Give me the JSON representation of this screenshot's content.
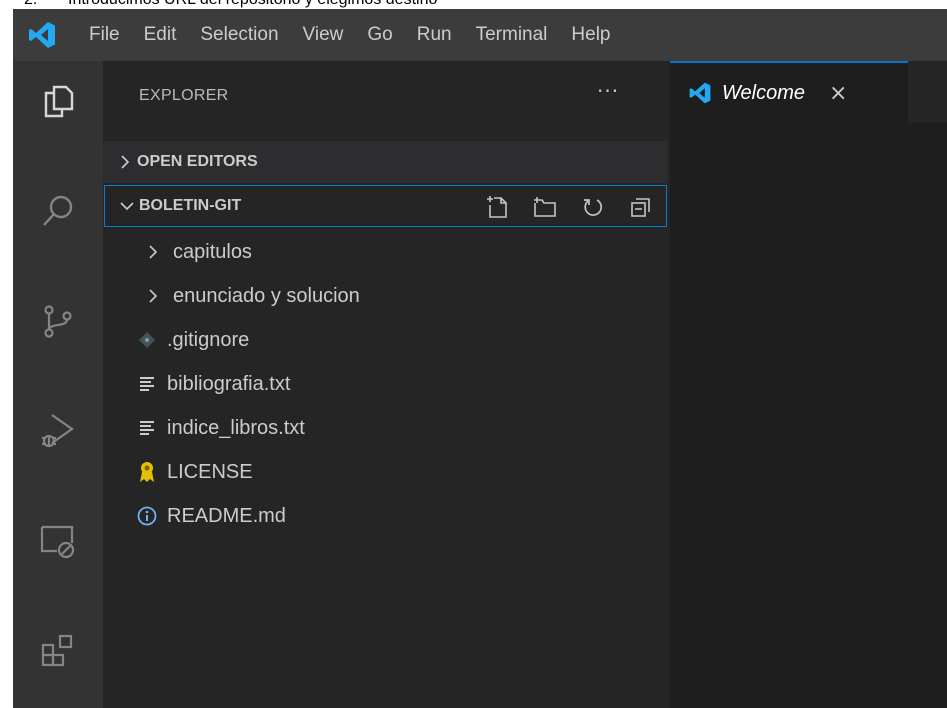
{
  "caption": {
    "number": "2.",
    "text": "Introducimos URL del repositorio y elegimos destino"
  },
  "menubar": {
    "items": [
      "File",
      "Edit",
      "Selection",
      "View",
      "Go",
      "Run",
      "Terminal",
      "Help"
    ]
  },
  "activity_bar": {
    "icons": [
      "explorer-icon",
      "search-icon",
      "source-control-icon",
      "run-debug-icon",
      "remote-explorer-icon",
      "extensions-icon"
    ]
  },
  "sidebar": {
    "title": "EXPLORER",
    "more_label": "···",
    "sections": [
      {
        "label": "OPEN EDITORS",
        "expanded": false
      },
      {
        "label": "BOLETIN-GIT",
        "expanded": true
      }
    ],
    "tree": [
      {
        "type": "folder",
        "label": "capitulos",
        "icon": "chevron-right-icon"
      },
      {
        "type": "folder",
        "label": "enunciado y solucion",
        "icon": "chevron-right-icon"
      },
      {
        "type": "file",
        "label": ".gitignore",
        "icon": "git-file-icon"
      },
      {
        "type": "file",
        "label": "bibliografia.txt",
        "icon": "text-file-icon"
      },
      {
        "type": "file",
        "label": "indice_libros.txt",
        "icon": "text-file-icon"
      },
      {
        "type": "file",
        "label": "LICENSE",
        "icon": "license-icon"
      },
      {
        "type": "file",
        "label": "README.md",
        "icon": "info-icon"
      }
    ]
  },
  "editor": {
    "tabs": [
      {
        "label": "Welcome",
        "active": true,
        "close": "×"
      }
    ]
  },
  "colors": {
    "accent": "#007fd4",
    "vscode_blue": "#23a9f2",
    "license_yellow": "#e5c000",
    "info_blue": "#6fb3f7"
  }
}
